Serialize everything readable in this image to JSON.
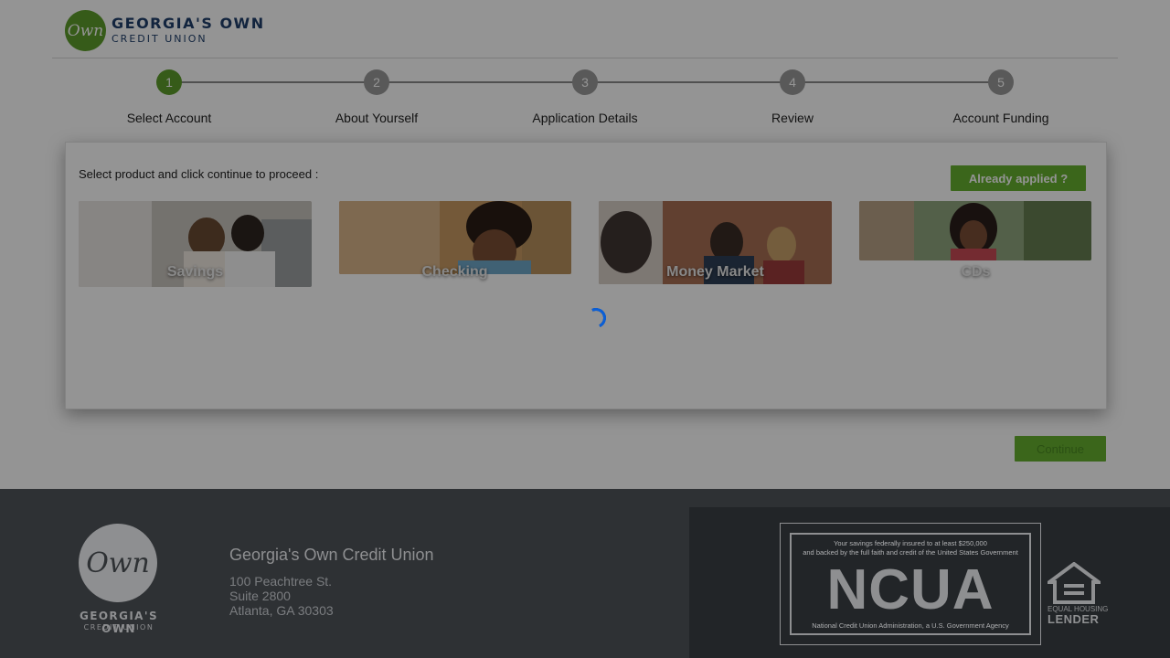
{
  "brand": {
    "logo_mark": "Own",
    "name_line1": "GEORGIA'S OWN",
    "name_line2": "CREDIT UNION",
    "accent_color": "#5d9e2b"
  },
  "stepper": {
    "current_step": 1,
    "steps": [
      {
        "number": "1",
        "label": "Select Account"
      },
      {
        "number": "2",
        "label": "About Yourself"
      },
      {
        "number": "3",
        "label": "Application Details"
      },
      {
        "number": "4",
        "label": "Review"
      },
      {
        "number": "5",
        "label": "Account Funding"
      }
    ]
  },
  "card": {
    "instruction": "Select product and click continue to proceed :",
    "already_applied_label": "Already applied ?",
    "products": [
      {
        "label": "Savings"
      },
      {
        "label": "Checking"
      },
      {
        "label": "Money Market"
      },
      {
        "label": "CDs"
      }
    ],
    "loading": true
  },
  "continue_label": "Continue",
  "footer": {
    "logo_mark": "Own",
    "logo_line1": "GEORGIA'S OWN",
    "logo_line2": "CREDIT UNION",
    "org_name": "Georgia's Own Credit Union",
    "address_line1": "100 Peachtree St.",
    "address_line2": "Suite 2800",
    "address_line3": "Atlanta, GA 30303",
    "ncua_top1": "Your savings federally insured to at least $250,000",
    "ncua_top2": "and backed by the full faith and credit of the United States Government",
    "ncua_big": "NCUA",
    "ncua_bottom": "National Credit Union Administration, a U.S. Government Agency",
    "ehl_line1": "EQUAL HOUSING",
    "ehl_line2": "LENDER"
  }
}
